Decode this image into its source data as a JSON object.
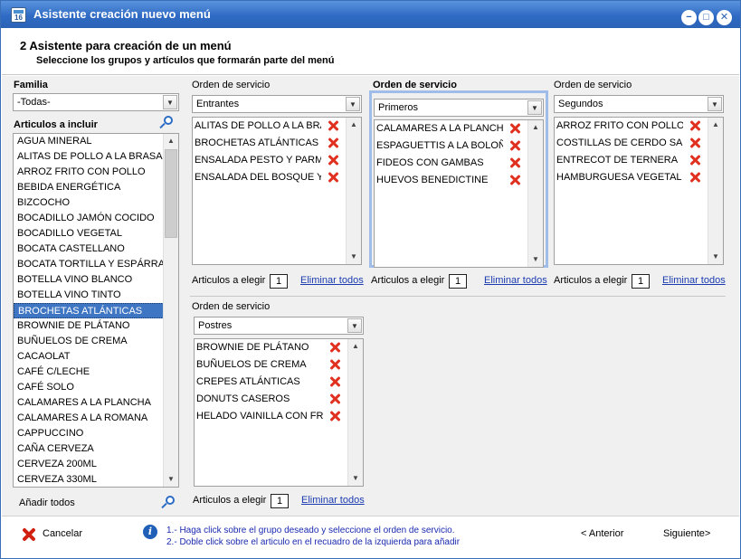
{
  "window": {
    "title": "Asistente creación nuevo menú",
    "min_glyph": "−",
    "max_glyph": "□",
    "close_glyph": "✕"
  },
  "header": {
    "step": "2",
    "title": "Asistente para creación de un menú",
    "subtitle": "Seleccione los grupos y artículos que formarán parte del menú"
  },
  "left": {
    "family_label": "Familia",
    "family_value": "-Todas-",
    "articles_label": "Articulos a incluir",
    "articles": [
      "AGUA MINERAL",
      "ALITAS DE POLLO A LA BRASA",
      "ARROZ FRITO CON POLLO",
      "BEBIDA ENERGÉTICA",
      "BIZCOCHO",
      "BOCADILLO JAMÓN COCIDO",
      "BOCADILLO VEGETAL",
      "BOCATA CASTELLANO",
      "BOCATA TORTILLA Y ESPÁRRAG",
      "BOTELLA VINO BLANCO",
      "BOTELLA VINO TINTO",
      "BROCHETAS ATLÁNTICAS",
      "BROWNIE DE PLÁTANO",
      "BUÑUELOS DE CREMA",
      "CACAOLAT",
      "CAFÉ C/LECHE",
      "CAFÉ SOLO",
      "CALAMARES A LA PLANCHA",
      "CALAMARES A LA ROMANA",
      "CAPPUCCINO",
      "CAÑA CERVEZA",
      "CERVEZA 200ML",
      "CERVEZA 330ML"
    ],
    "selected_article": "BROCHETAS ATLÁNTICAS",
    "add_all_label": "Añadir todos"
  },
  "groups": [
    {
      "label": "Orden de servicio",
      "label_bold": false,
      "value": "Entrantes",
      "items": [
        "ALITAS DE POLLO A LA BRA",
        "BROCHETAS ATLÁNTICAS",
        "ENSALADA PESTO Y PARME",
        "ENSALADA DEL BOSQUE Y I"
      ],
      "elegir_label": "Articulos a elegir",
      "elegir_value": "1",
      "remove_all_label": "Eliminar todos"
    },
    {
      "label": "Orden de servicio",
      "label_bold": true,
      "value": "Primeros",
      "items": [
        "CALAMARES A LA PLANCHA",
        "ESPAGUETTIS A LA BOLOÑE",
        "FIDEOS CON GAMBAS",
        "HUEVOS BENEDICTINE"
      ],
      "elegir_label": "Articulos a elegir",
      "elegir_value": "1",
      "remove_all_label": "Eliminar todos"
    },
    {
      "label": "Orden de servicio",
      "label_bold": false,
      "value": "Segundos",
      "items": [
        "ARROZ FRITO CON POLLO",
        "COSTILLAS DE CERDO SALS",
        "ENTRECOT DE TERNERA",
        "HAMBURGUESA VEGETAL A"
      ],
      "elegir_label": "Articulos a elegir",
      "elegir_value": "1",
      "remove_all_label": "Eliminar todos"
    },
    {
      "label": "Orden de servicio",
      "label_bold": false,
      "value": "Postres",
      "items": [
        "BROWNIE DE PLÁTANO",
        "BUÑUELOS DE CREMA",
        "CREPES ATLÁNTICAS",
        "DONUTS CASEROS",
        "HELADO VAINILLA CON FRU"
      ],
      "elegir_label": "Articulos a elegir",
      "elegir_value": "1",
      "remove_all_label": "Eliminar todos"
    }
  ],
  "footer": {
    "cancel_label": "Cancelar",
    "hint1": "1.- Haga click sobre el grupo deseado y seleccione el orden de servicio.",
    "hint2": "2.- Doble click sobre el articulo en el recuadro de la izquierda para añadir",
    "prev_label": "< Anterior",
    "next_label": "Siguiente>"
  },
  "colors": {
    "titlebar": "#2f6bc4",
    "selection": "#3f76c3",
    "active_group_border": "#9fbde8",
    "remove_icon": "#e03020",
    "link": "#1a3bb0",
    "hint_text": "#1a2ab0"
  }
}
